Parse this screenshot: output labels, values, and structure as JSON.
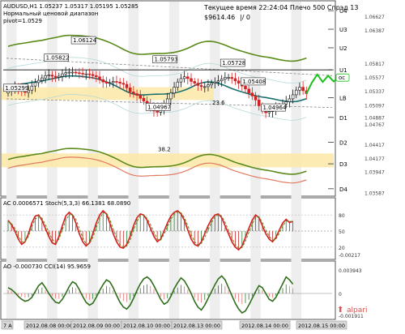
{
  "header": {
    "symbol_line": "AUDUSD,H1  1.05237 1.05317 1.05195 1.05285",
    "indicator_name": "Нормальный ценовой диапазон",
    "pivot_label": "pivot=1.0529",
    "server_time": "Текущее время 22:24:04 Плечо 500 Спрэд 13",
    "balance": "$9614.46",
    "separator": "|/ 0"
  },
  "colors": {
    "bull_candle": "#111111",
    "bear_candle": "#d42020",
    "main_ma": "#1a6f6f",
    "upper_band": "#5a8a1a",
    "lower_band": "#e07a5f",
    "forecast": "#1fbf1f",
    "zone_fill": "#fbe9a7",
    "stoch_main": "#d62020",
    "stoch_signal": "#5a8a1a",
    "cci_line": "#2f6e1a",
    "watermark": "#d9534f"
  },
  "chart_data": [
    {
      "type": "candlestick",
      "title": "AUDUSD,H1",
      "yticks": [
        "1.06627",
        "1.06387",
        "1.05817",
        "1.05577",
        "1.05337",
        "1.05097",
        "1.04887",
        "1.04767",
        "1.04417",
        "1.04177",
        "1.03947",
        "1.03587"
      ],
      "ylim": [
        1.0355,
        1.0682
      ],
      "close_series": [
        1.0534,
        1.0536,
        1.054,
        1.0538,
        1.0533,
        1.0531,
        1.0535,
        1.0542,
        1.0548,
        1.0552,
        1.0556,
        1.056,
        1.0561,
        1.0559,
        1.0557,
        1.0559,
        1.0563,
        1.0565,
        1.0566,
        1.0566,
        1.0565,
        1.0564,
        1.0563,
        1.0563,
        1.0562,
        1.056,
        1.0558,
        1.0553,
        1.0549,
        1.0547,
        1.0548,
        1.055,
        1.0549,
        1.0547,
        1.0545,
        1.0539,
        1.0532,
        1.0529,
        1.0526,
        1.0521,
        1.0516,
        1.051,
        1.0505,
        1.0499,
        1.0497,
        1.0502,
        1.051,
        1.052,
        1.053,
        1.054,
        1.0549,
        1.0555,
        1.0558,
        1.0555,
        1.055,
        1.0547,
        1.0543,
        1.0541,
        1.0541,
        1.0544,
        1.0547,
        1.0549,
        1.0551,
        1.0554,
        1.0557,
        1.0557,
        1.0555,
        1.0551,
        1.0547,
        1.0542,
        1.0537,
        1.053,
        1.0525,
        1.0518,
        1.0508,
        1.05,
        1.0496,
        1.0498,
        1.05,
        1.0505,
        1.0507,
        1.0511,
        1.0515,
        1.052,
        1.0527,
        1.0535,
        1.054,
        1.0534,
        1.0529
      ],
      "forecast": [
        1.0529,
        1.0548,
        1.0562,
        1.0549,
        1.056,
        1.055,
        1.0556
      ],
      "price_labels": [
        "1.06124",
        "1.05822",
        "1.05793",
        "1.05728",
        "1.05408",
        "1.05299",
        "1.04967",
        "1.04964"
      ],
      "price_label_values": [
        1.0612,
        1.0582,
        1.0579,
        1.0573,
        1.0541,
        1.053,
        1.0497,
        1.0496
      ],
      "levels": [
        {
          "name": "U4",
          "value": 1.0672
        },
        {
          "name": "U3",
          "value": 1.064
        },
        {
          "name": "U2",
          "value": 1.0608
        },
        {
          "name": "U1",
          "value": 1.057
        },
        {
          "name": "LB",
          "value": 1.0522
        },
        {
          "name": "D1",
          "value": 1.0488
        },
        {
          "name": "D2",
          "value": 1.0445
        },
        {
          "name": "D3",
          "value": 1.0408
        },
        {
          "name": "D4",
          "value": 1.0365
        }
      ],
      "value_labels": [
        "23.6",
        "38.2"
      ],
      "forecast_tag": "oc",
      "pivot_value": 1.0529
    },
    {
      "type": "line",
      "title": "AC  0.0006571   Stoch(5,3,3) 66.1381 68.0890",
      "yticks": [
        "80",
        "50",
        "20",
        "-0.00217"
      ],
      "ylim": [
        0,
        100
      ],
      "series": [
        {
          "values": [
            70,
            62,
            50,
            35,
            25,
            30,
            45,
            65,
            78,
            80,
            70,
            55,
            40,
            28,
            25,
            40,
            60,
            78,
            85,
            80,
            65,
            45,
            30,
            22,
            28,
            45,
            65,
            80,
            88,
            82,
            65,
            45,
            30,
            20,
            18,
            25,
            40,
            60,
            75,
            82,
            80,
            70,
            55,
            40,
            30,
            35,
            50,
            65,
            78,
            85,
            88,
            82,
            70,
            52,
            35,
            25,
            22,
            30,
            45,
            60,
            72,
            80,
            82,
            75,
            60,
            45,
            30,
            20,
            15,
            22,
            38,
            55,
            70,
            80,
            75,
            60,
            45,
            35,
            30,
            38,
            52,
            65,
            72,
            66,
            68
          ]
        },
        {
          "values": [
            68,
            64,
            55,
            42,
            30,
            30,
            40,
            58,
            72,
            78,
            74,
            62,
            48,
            35,
            28,
            35,
            52,
            70,
            80,
            81,
            72,
            55,
            38,
            26,
            26,
            38,
            56,
            73,
            84,
            84,
            72,
            54,
            38,
            25,
            20,
            22,
            33,
            52,
            68,
            78,
            80,
            74,
            62,
            48,
            35,
            33,
            44,
            58,
            72,
            81,
            86,
            84,
            75,
            60,
            44,
            30,
            24,
            27,
            38,
            52,
            66,
            76,
            81,
            78,
            66,
            52,
            37,
            25,
            18,
            19,
            31,
            47,
            63,
            75,
            77,
            66,
            52,
            40,
            33,
            35,
            46,
            59,
            69,
            68,
            68
          ]
        }
      ]
    },
    {
      "type": "line",
      "title": "AO  -0.000730   CCI(14) 95.9659",
      "yticks": [
        "0.003943",
        "0",
        "-0.001911"
      ],
      "ylim": [
        -250,
        250
      ],
      "series": [
        {
          "values": [
            60,
            40,
            10,
            -30,
            -60,
            -80,
            -70,
            -40,
            20,
            80,
            110,
            60,
            0,
            -50,
            -90,
            -100,
            -60,
            0,
            70,
            120,
            100,
            40,
            -30,
            -90,
            -120,
            -100,
            -40,
            30,
            90,
            140,
            120,
            60,
            -20,
            -90,
            -140,
            -160,
            -120,
            -50,
            30,
            100,
            150,
            170,
            140,
            80,
            10,
            -60,
            -110,
            -90,
            -30,
            50,
            110,
            160,
            130,
            70,
            0,
            -80,
            -140,
            -170,
            -120,
            -50,
            20,
            90,
            150,
            180,
            140,
            60,
            -20,
            -100,
            -160,
            -200,
            -180,
            -120,
            -50,
            20,
            80,
            60,
            0,
            -60,
            -80,
            -40,
            30,
            100,
            170,
            140,
            96
          ]
        }
      ]
    }
  ],
  "panels": {
    "ac": {
      "legend": "AC  0.0006571   Stoch(5,3,3) 66.1381 68.0890",
      "levels": [
        "80",
        "50",
        "20",
        "-0.00217"
      ]
    },
    "ao": {
      "legend": "AO  -0.000730   CCI(14) 95.9659",
      "levels": [
        "0.003943",
        "0",
        "-0.001911"
      ]
    }
  },
  "time_axis": [
    "7 A",
    "2012.08.08 00:00",
    "2012.08.09 00:00",
    "2012.08.10 00:00",
    "2012.08.13 00:00",
    "2012.08.14 00:00",
    "2012.08.15 00:00"
  ],
  "watermark": {
    "text": "alpari"
  }
}
